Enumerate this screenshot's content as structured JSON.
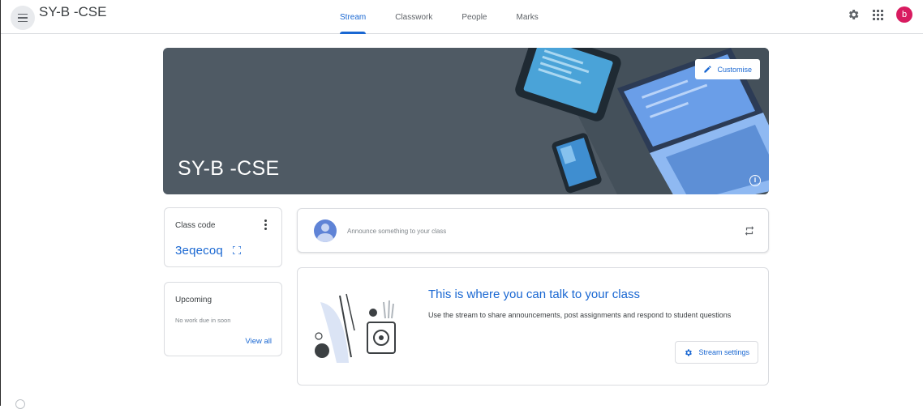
{
  "topbar": {
    "class_title": "SY-B -CSE",
    "tabs": [
      {
        "label": "Stream",
        "active": true
      },
      {
        "label": "Classwork",
        "active": false
      },
      {
        "label": "People",
        "active": false
      },
      {
        "label": "Marks",
        "active": false
      }
    ],
    "avatar_letter": "b",
    "avatar_color": "#d81b60",
    "icons": [
      "menu-icon",
      "gear-icon",
      "apps-icon"
    ]
  },
  "banner": {
    "title": "SY-B -CSE",
    "customise_label": "Customise",
    "background_color": "#4f5a64"
  },
  "class_code": {
    "label": "Class code",
    "value": "3eqecoq"
  },
  "upcoming": {
    "title": "Upcoming",
    "message": "No work due in soon",
    "link": "View all"
  },
  "announce": {
    "placeholder": "Announce something to your class"
  },
  "empty_stream": {
    "title": "This is where you can talk to your class",
    "description": "Use the stream to share announcements, post assignments and respond to student questions",
    "settings_button": "Stream settings"
  },
  "colors": {
    "accent": "#1967d2",
    "text": "#3c4043",
    "muted": "#80868b"
  }
}
